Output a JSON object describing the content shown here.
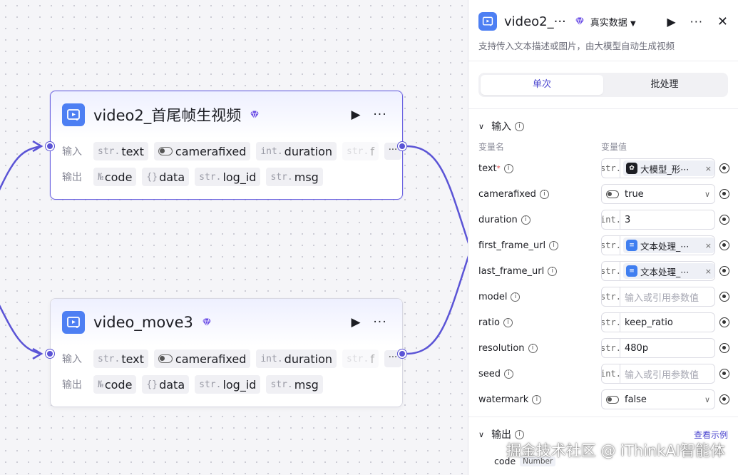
{
  "canvas": {
    "nodes": [
      {
        "title": "video2_首尾帧生视频",
        "input_label": "输入",
        "output_label": "输出",
        "inputs": [
          {
            "type": "str.",
            "name": "text"
          },
          {
            "type": "",
            "name": "camerafixed"
          },
          {
            "type": "int.",
            "name": "duration"
          },
          {
            "type": "str.",
            "name": "f"
          }
        ],
        "outputs": [
          {
            "type": "№",
            "name": "code"
          },
          {
            "type": "{}",
            "name": "data"
          },
          {
            "type": "str.",
            "name": "log_id"
          },
          {
            "type": "str.",
            "name": "msg"
          }
        ],
        "more": "···"
      },
      {
        "title": "video_move3",
        "input_label": "输入",
        "output_label": "输出",
        "inputs": [
          {
            "type": "str.",
            "name": "text"
          },
          {
            "type": "",
            "name": "camerafixed"
          },
          {
            "type": "int.",
            "name": "duration"
          },
          {
            "type": "str.",
            "name": "f"
          }
        ],
        "outputs": [
          {
            "type": "№",
            "name": "code"
          },
          {
            "type": "{}",
            "name": "data"
          },
          {
            "type": "str.",
            "name": "log_id"
          },
          {
            "type": "str.",
            "name": "msg"
          }
        ],
        "more": "···"
      }
    ]
  },
  "panel": {
    "title": "video2_···",
    "data_mode": "真实数据",
    "description": "支持传入文本描述或图片，由大模型自动生成视频",
    "tabs": [
      {
        "label": "单次",
        "active": true
      },
      {
        "label": "批处理",
        "active": false
      }
    ],
    "input_section": "输入",
    "col_name": "变量名",
    "col_value": "变量值",
    "params": [
      {
        "name": "text",
        "required": true,
        "kind": "ref",
        "type": "str.",
        "ref_label": "大模型_形···",
        "ref_icon": "llm"
      },
      {
        "name": "camerafixed",
        "kind": "toggle",
        "value": "true"
      },
      {
        "name": "duration",
        "kind": "text",
        "type": "int.",
        "value": "3"
      },
      {
        "name": "first_frame_url",
        "kind": "ref",
        "type": "str.",
        "ref_label": "文本处理_···",
        "ref_icon": "text"
      },
      {
        "name": "last_frame_url",
        "kind": "ref",
        "type": "str.",
        "ref_label": "文本处理_···",
        "ref_icon": "text"
      },
      {
        "name": "model",
        "kind": "placeholder",
        "type": "str.",
        "value": "输入或引用参数值"
      },
      {
        "name": "ratio",
        "kind": "text",
        "type": "str.",
        "value": "keep_ratio"
      },
      {
        "name": "resolution",
        "kind": "text",
        "type": "str.",
        "value": "480p"
      },
      {
        "name": "seed",
        "kind": "placeholder",
        "type": "int.",
        "value": "输入或引用参数值"
      },
      {
        "name": "watermark",
        "kind": "toggle",
        "value": "false"
      }
    ],
    "output_section": "输出",
    "example_link": "查看示例",
    "output_first": {
      "name": "code",
      "type": "Number"
    }
  },
  "watermark": "掘金技术社区 @ iThinkAI智能体",
  "colors": {
    "accent": "#5b54d6",
    "node_icon": "#4d7ff3",
    "ref_text_icon": "#3f7ef0",
    "gem": "#6b4ee6"
  }
}
